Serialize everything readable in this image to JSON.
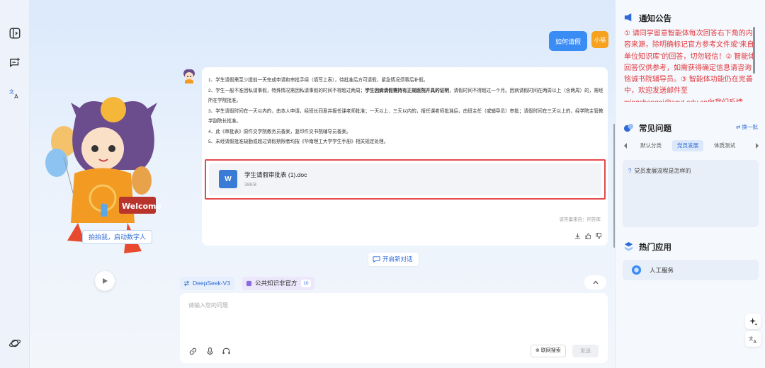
{
  "chat": {
    "user_message": "如何请假",
    "user_avatar_text": "小福",
    "answer_items": [
      "1、学生请假需至少提前一天完成申请和审批手续（填写上表），待批准后方可请假，紧急情况须事后补假。",
      "2、学生一般不准因私请事假，特殊情况需因私请事假的时间不得超过两周；",
      "3、学生请假时间在一天以内的，由本人申请，经班长同意并报任课老师批准；一天以上、三天以内的，报任课老师批准后，由班主任（或辅导员）审批；请假时间在三天以上的，经学院主管教学副院长批准。",
      "4、此《审批表》原件交学院教务员备案，复印件交书院辅导员备案。",
      "5、未经请假批准缺勤或超过请假期限者均按《华南理工大学学生手册》相关规定处理。"
    ],
    "answer_item2_bold": "学生因病请假需持有正规医院开具的证明",
    "answer_item2_tail": "，请假时间不得超过一个月。因病请假时间在两周以上（含两周）的，需经所在学院批准。",
    "file": {
      "icon_letter": "W",
      "name": "学生请假审批表 (1).doc",
      "size": "38KB"
    },
    "source": "该答案来自：问答库",
    "new_chat_label": "开启新对话",
    "model_label": "DeepSeek-V3",
    "kb_label": "公共知识非官方",
    "kb_badge": "10",
    "input_placeholder": "请输入您的问题",
    "web_search_label": "⊕ 联网搜索",
    "send_label": "发送"
  },
  "avatar": {
    "hint": "拍拍我，启动数字人",
    "welcome_text": "Welcome"
  },
  "right": {
    "notice_title": "通知公告",
    "notice_text": "① 请同学留意智能体每次回答右下角的内容来源，除明确标记官方参考文件或“来自单位知识库”的回答，切勿轻信！② 智能体回答仅供参考，如需获得确定信息请咨询铭诚书院辅导员。③ 智能体功能仍在完善中，欢迎发送邮件至mingchengai@scut.edu.cn向我们反馈",
    "faq_title": "常见问题",
    "swap_label": "⇄ 换一批",
    "tabs": [
      "默认分类",
      "党员发展",
      "体质测试"
    ],
    "faq_question": "党员发展流程是怎样的",
    "apps_title": "热门应用",
    "app_item": "人工服务"
  },
  "colors": {
    "accent": "#3a8cf5",
    "notice_red": "#e0383e",
    "highlight_border": "#e5484d"
  }
}
